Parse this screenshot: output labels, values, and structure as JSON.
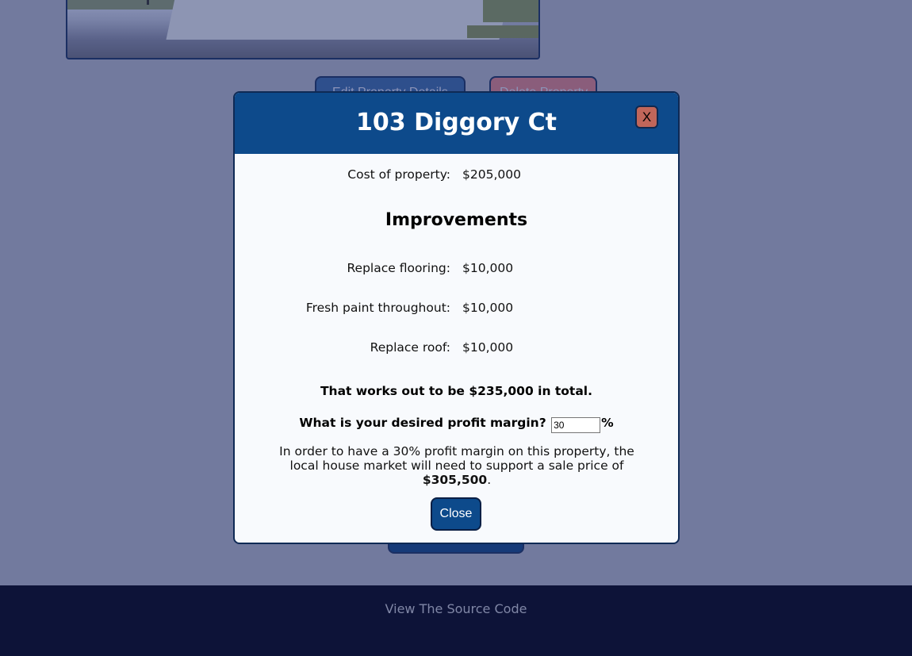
{
  "background": {
    "edit_button_label": "Edit Property Details",
    "delete_button_label": "Delete Property"
  },
  "modal": {
    "title": "103 Diggory Ct",
    "close_x_label": "X",
    "cost": {
      "label": "Cost of property:",
      "value": "$205,000"
    },
    "improvements_title": "Improvements",
    "improvements": [
      {
        "label": "Replace flooring:",
        "value": "$10,000"
      },
      {
        "label": "Fresh paint throughout:",
        "value": "$10,000"
      },
      {
        "label": "Replace roof:",
        "value": "$10,000"
      }
    ],
    "total_prefix": "That works out to be ",
    "total_value": "$235,000",
    "total_suffix": " in total.",
    "margin_question": "What is your desired profit margin?",
    "margin_value": "30",
    "margin_unit": "%",
    "explain_text": "In order to have a 30% profit margin on this property, the local house market will need to support a sale price of ",
    "sale_price": "$305,500",
    "explain_end": ".",
    "close_button_label": "Close"
  },
  "footer": {
    "source_link": "View The Source Code"
  },
  "colors": {
    "overlay": "#727a9e",
    "header": "#0d4a8b",
    "footer": "#0d1338",
    "close_x": "#c0665a"
  }
}
